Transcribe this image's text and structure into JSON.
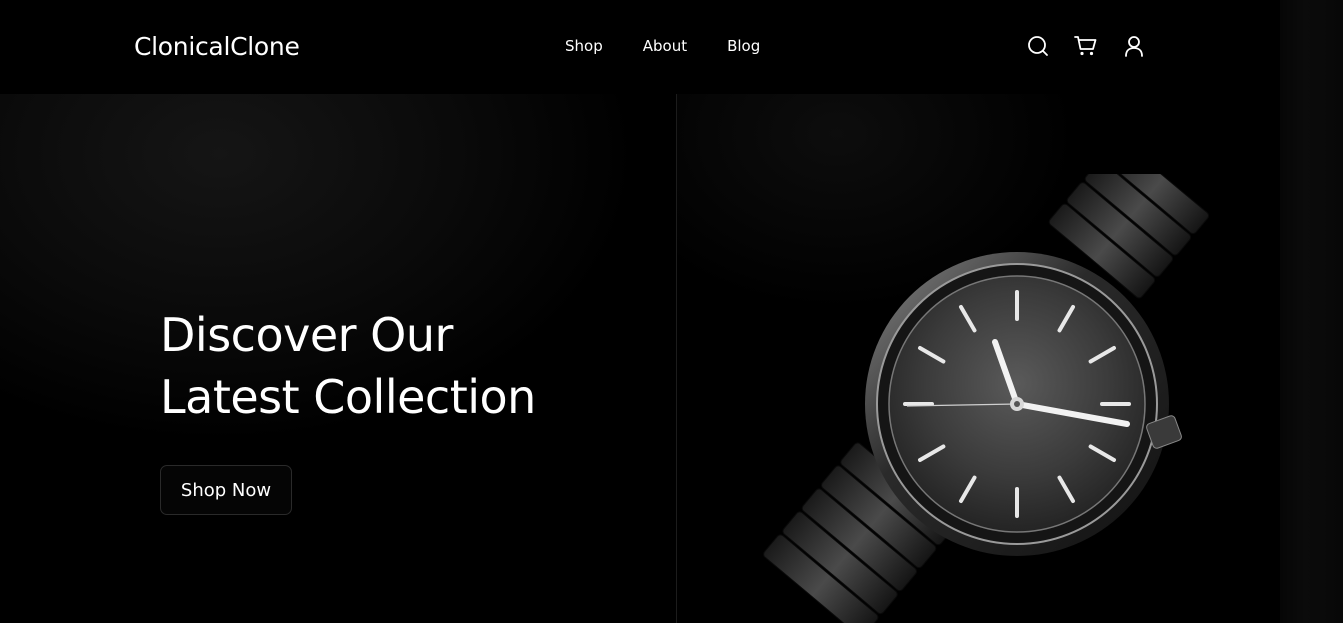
{
  "brand": {
    "name": "ClonicalClone"
  },
  "nav": {
    "items": [
      {
        "label": "Shop"
      },
      {
        "label": "About"
      },
      {
        "label": "Blog"
      }
    ]
  },
  "header_icons": [
    "search-icon",
    "cart-icon",
    "user-icon"
  ],
  "hero": {
    "title_line1": "Discover Our",
    "title_line2": "Latest Collection",
    "cta_label": "Shop Now"
  },
  "colors": {
    "background": "#000000",
    "text": "#ffffff",
    "button_border": "#2a2a2a"
  }
}
